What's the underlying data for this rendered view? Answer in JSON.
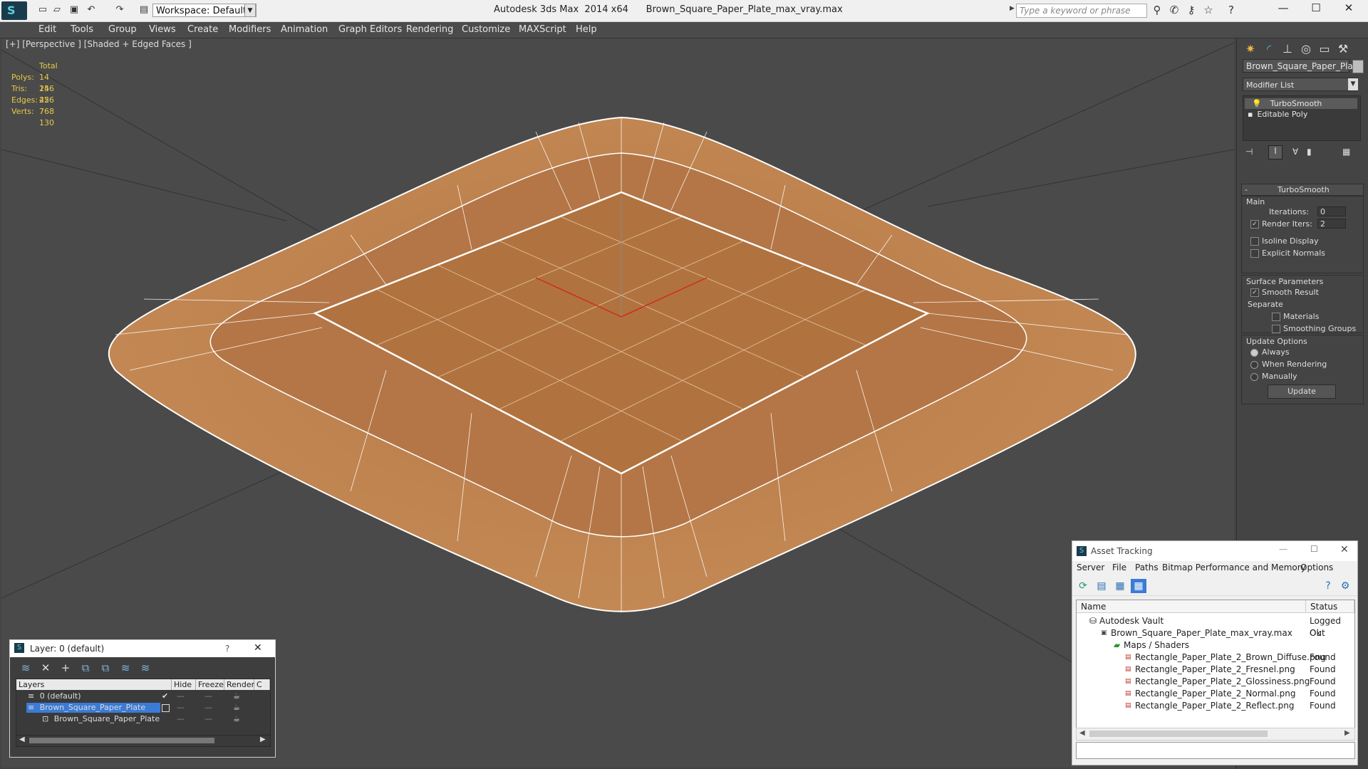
{
  "titlebar": {
    "workspace": "Workspace: Default",
    "app_title": "Autodesk 3ds Max  2014 x64      Brown_Square_Paper_Plate_max_vray.max",
    "search_placeholder": "Type a keyword or phrase"
  },
  "menu": [
    "Edit",
    "Tools",
    "Group",
    "Views",
    "Create",
    "Modifiers",
    "Animation",
    "Graph Editors",
    "Rendering",
    "Customize",
    "MAXScript",
    "Help"
  ],
  "viewport": {
    "label": "[+] [Perspective ] [Shaded + Edged Faces ]",
    "stats": {
      "header": "Total",
      "rows": [
        {
          "label": "Polys:",
          "value": "14 256"
        },
        {
          "label": "Tris:",
          "value": "14 256"
        },
        {
          "label": "Edges:",
          "value": "42 768"
        },
        {
          "label": "Verts:",
          "value": "7 130"
        }
      ]
    }
  },
  "command_panel": {
    "object_name": "Brown_Square_Paper_Plate",
    "modifier_list": "Modifier List",
    "stack": [
      "TurboSmooth",
      "Editable Poly"
    ],
    "turbosmooth": {
      "title": "TurboSmooth",
      "main": "Main",
      "iterations_label": "Iterations:",
      "iterations": "0",
      "render_iters_label": "Render Iters:",
      "render_iters": "2",
      "isoline": "Isoline Display",
      "explicit": "Explicit Normals",
      "surface_params": "Surface Parameters",
      "smooth_result": "Smooth Result",
      "separate": "Separate",
      "materials": "Materials",
      "smoothing_groups": "Smoothing Groups",
      "update_options": "Update Options",
      "always": "Always",
      "when_rendering": "When Rendering",
      "manually": "Manually",
      "update": "Update"
    }
  },
  "layer_window": {
    "title": "Layer: 0 (default)",
    "help": "?",
    "columns": [
      "Layers",
      "Hide",
      "Freeze",
      "Render",
      "C"
    ],
    "rows": [
      {
        "name": "0 (default)"
      },
      {
        "name": "Brown_Square_Paper_Plate"
      },
      {
        "name": "Brown_Square_Paper_Plate"
      }
    ]
  },
  "asset_tracking": {
    "title": "Asset Tracking",
    "menu": [
      "Server",
      "File",
      "Paths",
      "Bitmap Performance and Memory",
      "Options"
    ],
    "columns": [
      "Name",
      "Status"
    ],
    "rows": [
      {
        "name": "Autodesk Vault",
        "status": "Logged Out"
      },
      {
        "name": "Brown_Square_Paper_Plate_max_vray.max",
        "status": "Ok"
      },
      {
        "name": "Maps / Shaders",
        "status": ""
      },
      {
        "name": "Rectangle_Paper_Plate_2_Brown_Diffuse.png",
        "status": "Found"
      },
      {
        "name": "Rectangle_Paper_Plate_2_Fresnel.png",
        "status": "Found"
      },
      {
        "name": "Rectangle_Paper_Plate_2_Glossiness.png",
        "status": "Found"
      },
      {
        "name": "Rectangle_Paper_Plate_2_Normal.png",
        "status": "Found"
      },
      {
        "name": "Rectangle_Paper_Plate_2_Reflect.png",
        "status": "Found"
      }
    ]
  },
  "colors": {
    "plate": "#b87a48",
    "wire": "#ffffff",
    "viewport_bg": "#4a4a4a",
    "selection": "#3a7bd5"
  }
}
